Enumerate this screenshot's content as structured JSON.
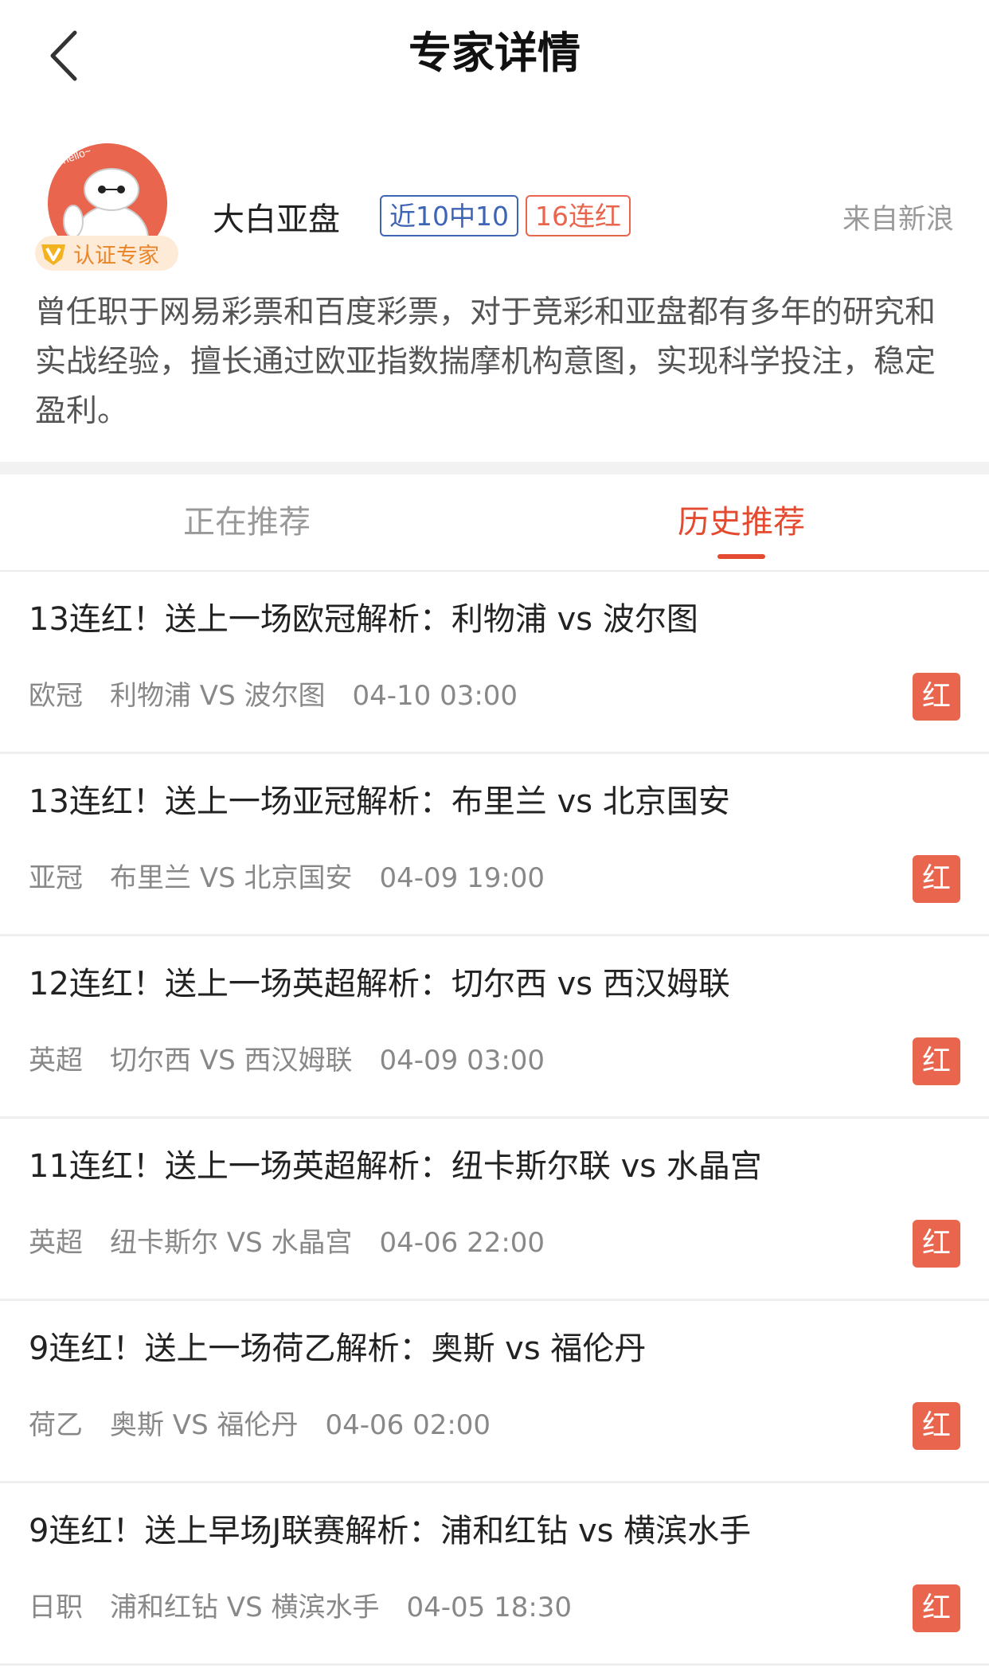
{
  "header": {
    "title": "专家详情",
    "back_icon": "chevron-left-icon"
  },
  "profile": {
    "avatar_icon": "baymax-avatar",
    "certified_label": "认证专家",
    "name": "大白亚盘",
    "tag_recent": "近10中10",
    "tag_streak": "16连红",
    "source": "来自新浪",
    "bio": "曾任职于网易彩票和百度彩票，对于竞彩和亚盘都有多年的研究和实战经验，擅长通过欧亚指数揣摩机构意图，实现科学投注，稳定盈利。",
    "colors": {
      "accent_red": "#e44a2f",
      "tag_blue": "#3e64b6",
      "badge_orange": "#e9862a"
    }
  },
  "tabs": [
    {
      "label": "正在推荐",
      "active": false
    },
    {
      "label": "历史推荐",
      "active": true
    }
  ],
  "items": [
    {
      "title": "13连红！送上一场欧冠解析：利物浦 vs 波尔图",
      "league": "欧冠",
      "match": "利物浦 VS 波尔图",
      "time": "04-10 03:00",
      "result": "红"
    },
    {
      "title": "13连红！送上一场亚冠解析：布里兰 vs 北京国安",
      "league": "亚冠",
      "match": "布里兰 VS 北京国安",
      "time": "04-09 19:00",
      "result": "红"
    },
    {
      "title": "12连红！送上一场英超解析：切尔西 vs 西汉姆联",
      "league": "英超",
      "match": "切尔西 VS 西汉姆联",
      "time": "04-09 03:00",
      "result": "红"
    },
    {
      "title": "11连红！送上一场英超解析：纽卡斯尔联 vs 水晶宫",
      "league": "英超",
      "match": "纽卡斯尔 VS 水晶宫",
      "time": "04-06 22:00",
      "result": "红"
    },
    {
      "title": "9连红！送上一场荷乙解析：奥斯 vs 福伦丹",
      "league": "荷乙",
      "match": "奥斯 VS 福伦丹",
      "time": "04-06 02:00",
      "result": "红"
    },
    {
      "title": "9连红！送上早场J联赛解析：浦和红钻 vs 横滨水手",
      "league": "日职",
      "match": "浦和红钻 VS 横滨水手",
      "time": "04-05 18:30",
      "result": "红"
    }
  ]
}
